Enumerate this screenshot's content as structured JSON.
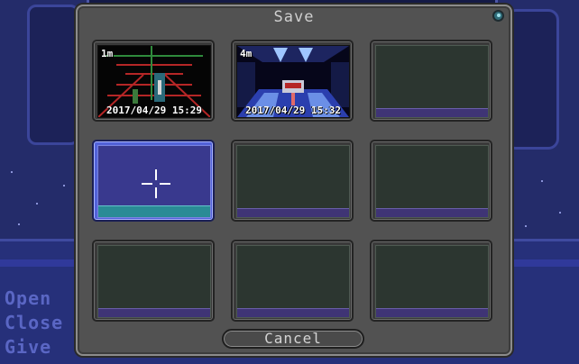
{
  "background": {
    "verbs": [
      "Open",
      "Close",
      "Give"
    ]
  },
  "dialog": {
    "title": "Save",
    "cancel_label": "Cancel",
    "slots": [
      {
        "filled": true,
        "room": "1m",
        "timestamp": "2017/04/29 15:29"
      },
      {
        "filled": true,
        "room": "4m",
        "timestamp": "2017/04/29 15:32"
      },
      {
        "filled": false
      },
      {
        "filled": false,
        "selected": true
      },
      {
        "filled": false
      },
      {
        "filled": false
      },
      {
        "filled": false
      },
      {
        "filled": false
      },
      {
        "filled": false
      }
    ]
  },
  "colors": {
    "dialog_bg": "#525252",
    "selected_slot": "#5262d8",
    "empty_slot": "#2c3630",
    "slot_bar": "#3f3475",
    "verb_text": "#5a66c4"
  }
}
